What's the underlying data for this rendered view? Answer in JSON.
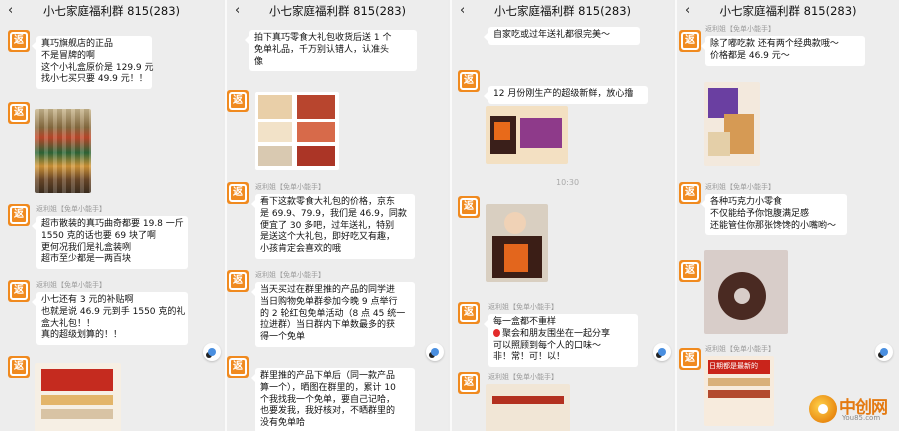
{
  "screens": [
    {
      "title": "小七家庭福利群 815(283)"
    },
    {
      "title": "小七家庭福利群 815(283)"
    },
    {
      "title": "小七家庭福利群 815(283)"
    },
    {
      "title": "小七家庭福利群 815(283)"
    }
  ],
  "sender_name": "返利姐【免单小能手】",
  "timestamp": "10:30",
  "watermark": {
    "text": "中创网",
    "url": "You85.com"
  },
  "messages": {
    "p1m1": [
      "真巧旗舰店的正品",
      "不是冒牌的啊",
      "这个小礼盒原价是 129.9 元",
      "找小七买只要 49.9 元！！"
    ],
    "p1m3": [
      "超市散装的真巧曲奇都要 19.8 一斤",
      "1550 克的话也要 69 块了啊",
      "更何况我们是礼盒装咧",
      "超市至少都是一两百块"
    ],
    "p1m4": [
      "小七还有 3 元的补贴啊",
      "也就是说 46.9 元到手 1550 克的礼",
      "盒大礼包！！",
      "真的超级划算的！！"
    ],
    "p2m1": [
      "拍下真巧零食大礼包收货后送 1 个",
      "免单礼品，千万别认错人，认准头",
      "像"
    ],
    "p2m3": [
      "看下这款零食大礼包的价格，京东",
      "是 69.9、79.9，我们是 46.9，同款",
      "便宜了 30 多吧，过年送礼，特别",
      "是送这个大礼包，即好吃又有趣，",
      "小孩肯定会喜欢的哦"
    ],
    "p2m4": [
      "当天买过在群里推的产品的同学进",
      "当日购物免单群参加今晚 9 点举行",
      "的 2 轮红包免单活动（8 点 45 统一",
      "拉进群）当日群内下单数最多的获",
      "得一个免单"
    ],
    "p2m5": [
      "群里推的产品下单后（同一款产品",
      "算一个），晒图在群里的，累计 10",
      "个我找我一个免单，要自己记哈，",
      "也要发我，我好核对，不晒群里的",
      "没有免单哈"
    ],
    "p3m0": [
      "自家吃或过年送礼都很完美～"
    ],
    "p3m1": [
      "12 月份刚生产的超级新鲜，放心撸"
    ],
    "p3m3": [
      "每一盒都不重样",
      "聚会和朋友围坐在一起分享",
      "可以照顾到每个人的口味～",
      "非！常！可！以！"
    ],
    "p4m1": [
      "除了嘟吃款 还有两个经典款哦～",
      "价格都是 46.9 元～"
    ],
    "p4m3": [
      "各种巧克力小零食",
      "不仅能给予你饱腹满足感",
      "还能管住你那张馋馋的小嘴哟～"
    ],
    "p4photo": "日期都是最新的"
  }
}
